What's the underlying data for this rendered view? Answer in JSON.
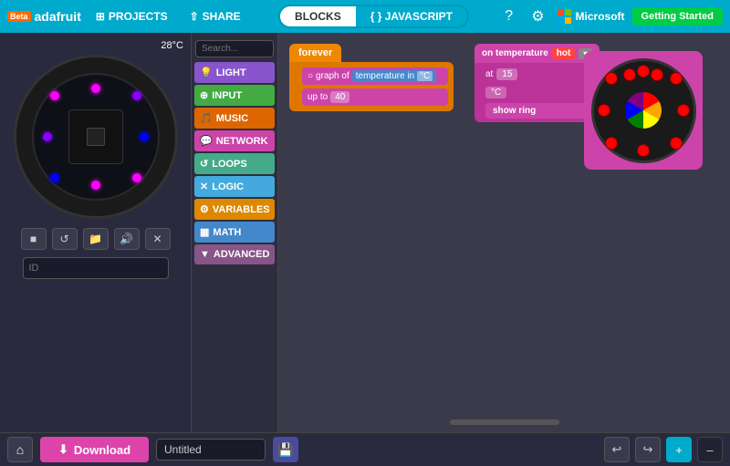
{
  "topbar": {
    "logo_text": "adafruit",
    "beta": "Beta",
    "projects_label": "PROJECTS",
    "share_label": "SHARE",
    "blocks_tab": "BLOCKS",
    "javascript_tab": "{ } JAVASCRIPT",
    "getting_started": "Getting Started"
  },
  "sidebar": {
    "temp": "28°C",
    "controls": [
      "■",
      "↺",
      "📁",
      "🔊",
      "✕"
    ],
    "id_placeholder": "ID"
  },
  "blocks_panel": {
    "search_placeholder": "Search...",
    "categories": [
      {
        "id": "light",
        "label": "LIGHT",
        "icon": "💡",
        "color": "#8855cc"
      },
      {
        "id": "input",
        "label": "INPUT",
        "icon": "⊕",
        "color": "#44aa44"
      },
      {
        "id": "music",
        "label": "MUSIC",
        "icon": "🎵",
        "color": "#dd6600"
      },
      {
        "id": "network",
        "label": "NETWORK",
        "icon": "💬",
        "color": "#cc44aa"
      },
      {
        "id": "loops",
        "label": "LOOPS",
        "icon": "↺",
        "color": "#44aa88"
      },
      {
        "id": "logic",
        "label": "LOGIC",
        "icon": "✕",
        "color": "#44aadd"
      },
      {
        "id": "variables",
        "label": "VARIABLES",
        "icon": "⚙",
        "color": "#dd8800"
      },
      {
        "id": "math",
        "label": "MATH",
        "icon": "▦",
        "color": "#4488cc"
      },
      {
        "id": "advanced",
        "label": "ADVANCED",
        "icon": "▼",
        "color": "#885588"
      }
    ]
  },
  "workspace": {
    "forever_label": "forever",
    "graph_label": "graph of",
    "temperature_label": "temperature in",
    "unit_label": "°C",
    "up_to_label": "up to",
    "up_to_val": "40",
    "on_temp_label": "on temperature",
    "hot_label": "hot",
    "at_label": "at",
    "at_val": "15",
    "unit2_label": "°C",
    "show_ring_label": "show ring"
  },
  "bottombar": {
    "download_label": "Download",
    "filename": "Untitled",
    "undo": "↩",
    "redo": "↪",
    "zoom_in": "+",
    "zoom_out": "–"
  }
}
